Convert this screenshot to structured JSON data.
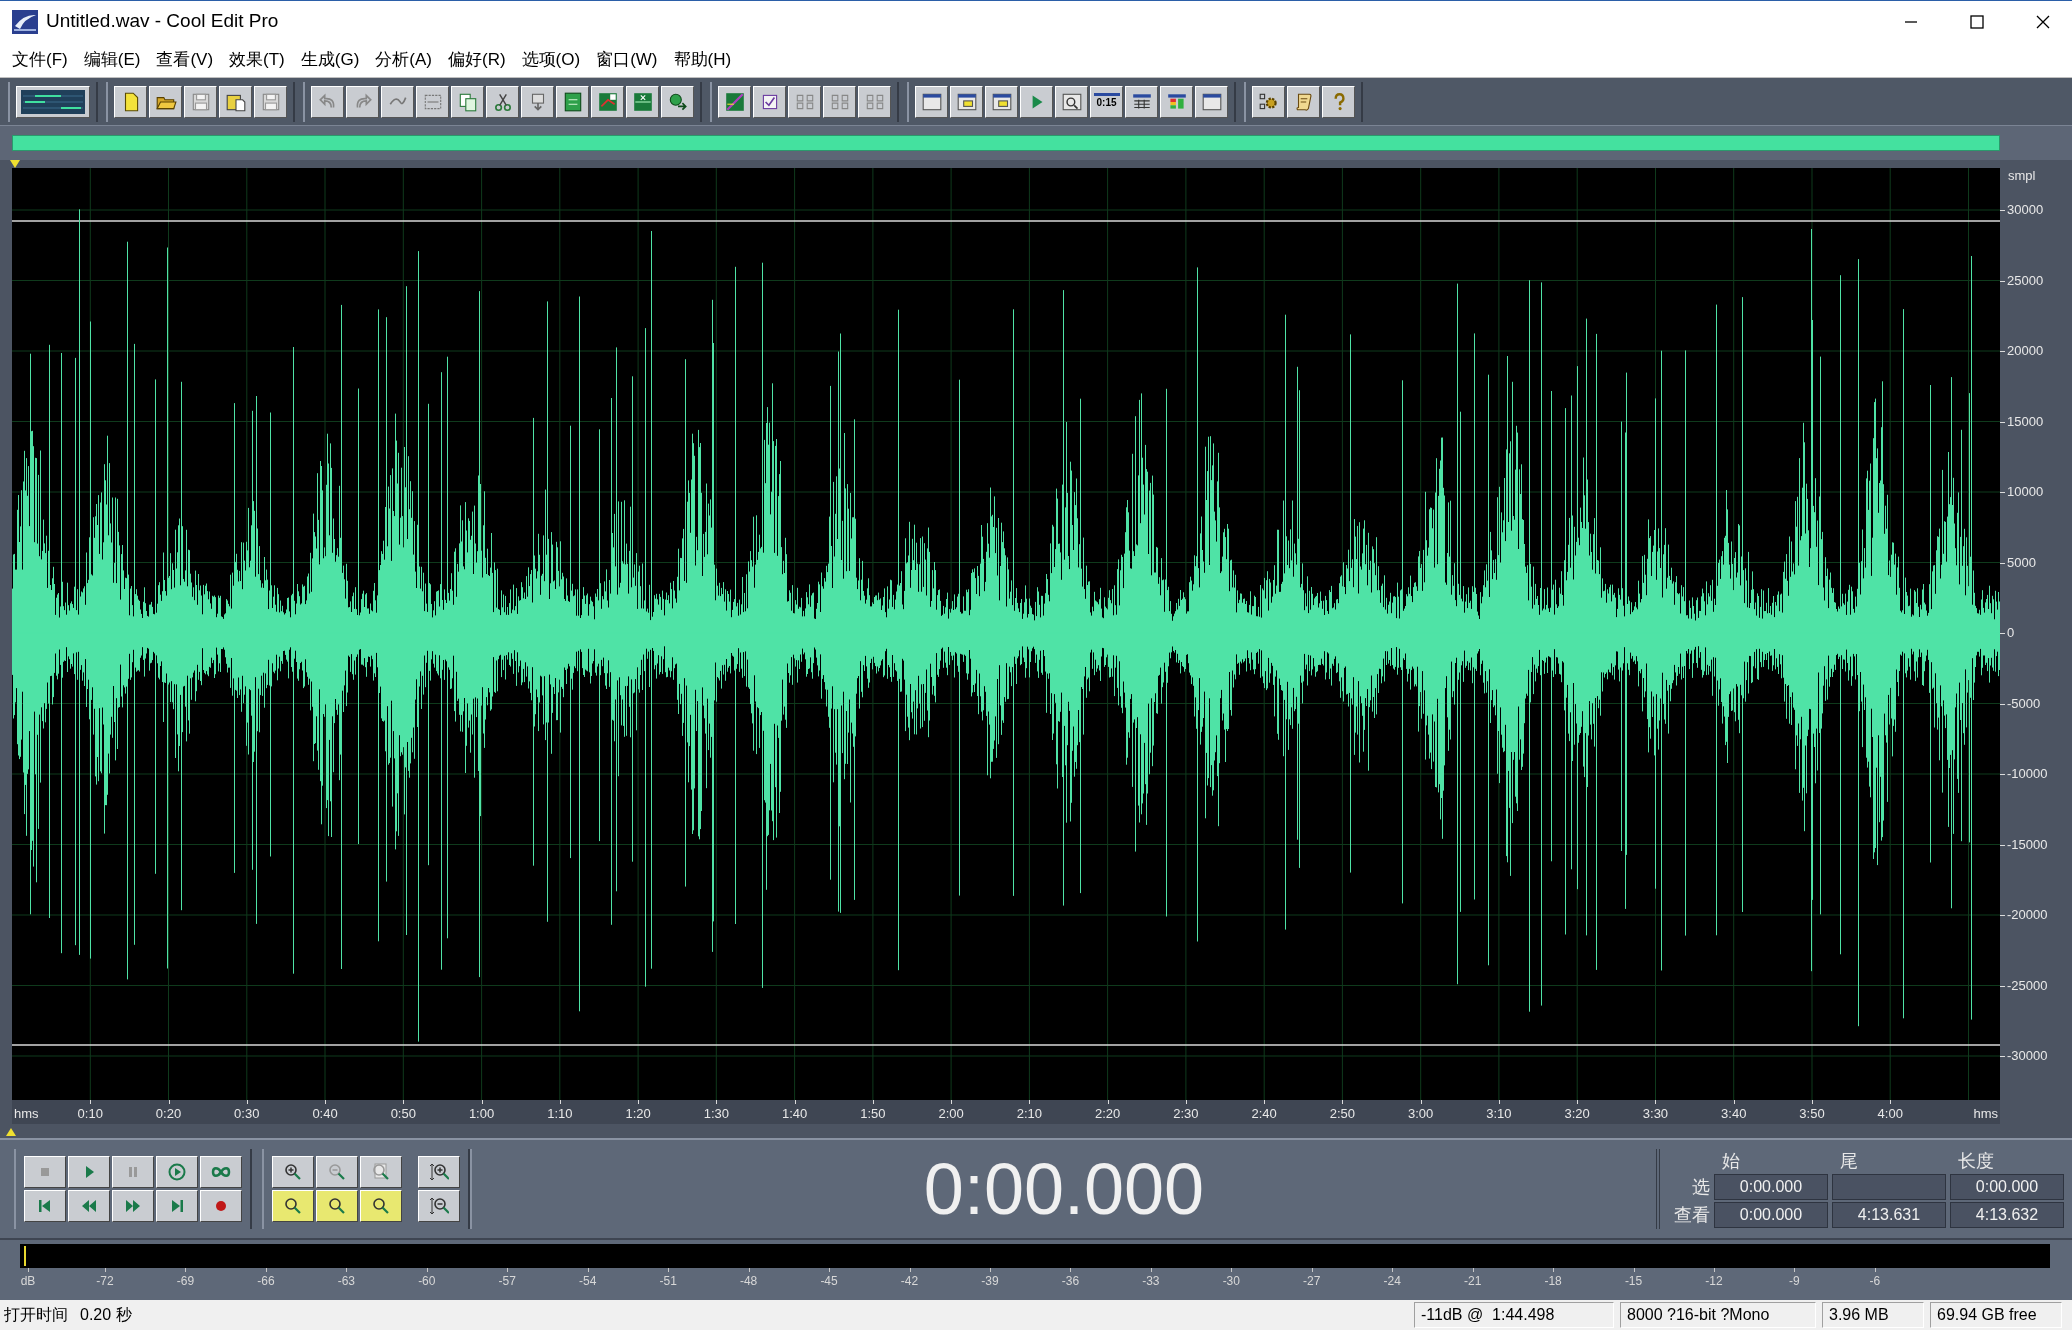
{
  "window": {
    "title": "Untitled.wav - Cool Edit Pro"
  },
  "menu": [
    "文件(F)",
    "编辑(E)",
    "查看(V)",
    "效果(T)",
    "生成(G)",
    "分析(A)",
    "偏好(R)",
    "选项(O)",
    "窗口(W)",
    "帮助(H)"
  ],
  "toolbar": {
    "time_button_label": "0:15"
  },
  "waveform": {
    "y_unit": "smpl",
    "y_ticks": [
      "30000",
      "25000",
      "20000",
      "15000",
      "10000",
      "5000",
      "0",
      "-5000",
      "-10000",
      "-15000",
      "-20000",
      "-25000",
      "-30000"
    ],
    "x_start_unit": "hms",
    "x_ticks": [
      "0:10",
      "0:20",
      "0:30",
      "0:40",
      "0:50",
      "1:00",
      "1:10",
      "1:20",
      "1:30",
      "1:40",
      "1:50",
      "2:00",
      "2:10",
      "2:20",
      "2:30",
      "2:40",
      "2:50",
      "3:00",
      "3:10",
      "3:20",
      "3:30",
      "3:40",
      "3:50",
      "4:00"
    ],
    "x_end_unit": "hms"
  },
  "transport": {
    "time": "0:00.000"
  },
  "selection": {
    "headers": [
      "始",
      "尾",
      "长度"
    ],
    "rows": [
      {
        "label": "选",
        "begin": "0:00.000",
        "length": "0:00.000"
      },
      {
        "label": "查看",
        "begin": "0:00.000",
        "end": "4:13.631",
        "length": "4:13.632"
      }
    ]
  },
  "level_meter": {
    "labels": [
      "dB",
      "-72",
      "-69",
      "-66",
      "-63",
      "-60",
      "-57",
      "-54",
      "-51",
      "-48",
      "-45",
      "-42",
      "-39",
      "-36",
      "-33",
      "-30",
      "-27",
      "-24",
      "-21",
      "-18",
      "-15",
      "-12",
      "-9",
      "-6"
    ]
  },
  "status_bar": {
    "label": "打开时间",
    "value": "0.20 秒",
    "cells": [
      "-11dB @  1:44.498",
      "8000 ?16-bit ?Mono",
      "3.96 MB",
      "69.94 GB free"
    ]
  }
}
